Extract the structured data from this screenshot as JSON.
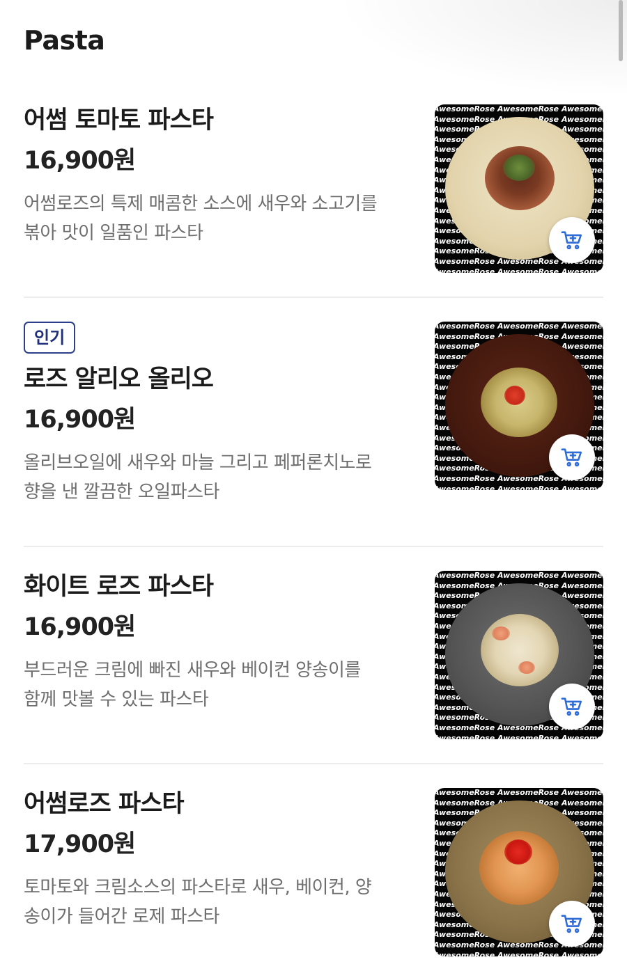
{
  "section": {
    "title": "Pasta"
  },
  "watermark_text": "AwesomeRose AwesomeRose AwesomeRose AwesomeRose",
  "accent_color": "#2d6bd6",
  "badge_color": "#2d3e8a",
  "items": [
    {
      "name": "어썸 토마토 파스타",
      "price": "16,900원",
      "desc_line1": "어썸로즈의 특제 매콤한 소스에 새우와 소고기를",
      "desc_line2": "볶아 맛이 일품인 파스타",
      "badge": "",
      "cart_icon": "add-to-cart-icon"
    },
    {
      "name": "로즈 알리오 올리오",
      "price": "16,900원",
      "desc_line1": "올리브오일에 새우와 마늘 그리고 페퍼론치노로",
      "desc_line2": "향을 낸 깔끔한 오일파스타",
      "badge": "인기",
      "cart_icon": "add-to-cart-icon"
    },
    {
      "name": "화이트 로즈 파스타",
      "price": "16,900원",
      "desc_line1": "부드러운 크림에 빠진 새우와 베이컨 양송이를",
      "desc_line2": "함께 맛볼 수 있는 파스타",
      "badge": "",
      "cart_icon": "add-to-cart-icon"
    },
    {
      "name": "어썸로즈 파스타",
      "price": "17,900원",
      "desc_line1": "토마토와 크림소스의 파스타로 새우, 베이컨, 양",
      "desc_line2": "송이가 들어간 로제 파스타",
      "badge": "",
      "cart_icon": "add-to-cart-icon"
    }
  ]
}
